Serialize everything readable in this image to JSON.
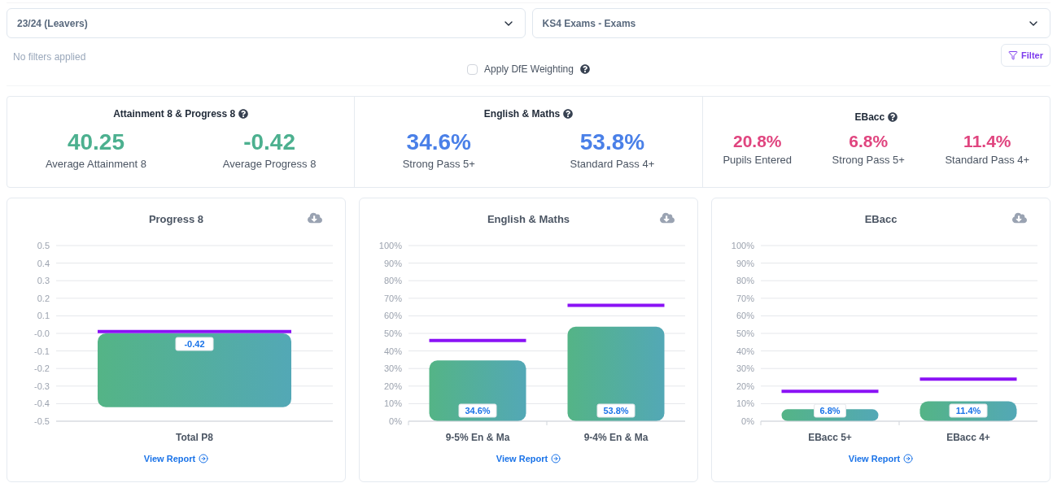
{
  "selects": [
    {
      "value": "23/24 (Leavers)"
    },
    {
      "value": "KS4 Exams - Exams"
    }
  ],
  "filters": {
    "status": "No filters applied",
    "button": "Filter"
  },
  "weighting": {
    "label": "Apply DfE Weighting",
    "checked": false
  },
  "summary": [
    {
      "title": "Attainment 8 & Progress 8",
      "color": "#4cb08f",
      "metrics": [
        {
          "value": "40.25",
          "label": "Average Attainment 8"
        },
        {
          "value": "-0.42",
          "label": "Average Progress 8"
        }
      ]
    },
    {
      "title": "English & Maths",
      "color": "#4a80e8",
      "metrics": [
        {
          "value": "34.6%",
          "label": "Strong Pass 5+"
        },
        {
          "value": "53.8%",
          "label": "Standard Pass 4+"
        }
      ]
    },
    {
      "title": "EBacc",
      "color": "#e0457f",
      "metrics": [
        {
          "value": "20.8%",
          "label": "Pupils Entered"
        },
        {
          "value": "6.8%",
          "label": "Strong Pass 5+"
        },
        {
          "value": "11.4%",
          "label": "Standard Pass 4+"
        }
      ]
    }
  ],
  "charts": [
    {
      "link": "View Report",
      "chart_data": {
        "type": "bar",
        "title": "Progress 8",
        "grid": true,
        "categories": [
          "Total P8"
        ],
        "series": [
          {
            "color": "#54b486",
            "values": [
              -0.42
            ]
          }
        ],
        "ref_lines": [
          {
            "axis": "y",
            "value": 0.01,
            "color": "#8a12f5"
          }
        ],
        "ylim": [
          -0.5,
          0.5
        ],
        "yticks": [
          {
            "value": 0.5,
            "label": "0.5"
          },
          {
            "value": 0.4,
            "label": "0.4"
          },
          {
            "value": 0.3,
            "label": "0.3"
          },
          {
            "value": 0.2,
            "label": "0.2"
          },
          {
            "value": 0.1,
            "label": "0.1"
          },
          {
            "value": 0,
            "label": "-0.0"
          },
          {
            "value": -0.1,
            "label": "-0.1"
          },
          {
            "value": -0.2,
            "label": "-0.2"
          },
          {
            "value": -0.3,
            "label": "-0.3"
          },
          {
            "value": -0.4,
            "label": "-0.4"
          },
          {
            "value": -0.5,
            "label": "-0.5"
          }
        ],
        "value_labels": [
          "-0.42"
        ]
      }
    },
    {
      "link": "View Report",
      "chart_data": {
        "type": "bar",
        "title": "English & Maths",
        "grid": true,
        "categories": [
          "9-5% En & Ma",
          "9-4% En & Ma"
        ],
        "series": [
          {
            "color": "#54b486",
            "values": [
              34.6,
              53.8
            ]
          }
        ],
        "ref_lines": [
          {
            "axis": "y",
            "value": 46,
            "color": "#8a12f5"
          },
          {
            "axis": "y",
            "value": 66,
            "color": "#8a12f5"
          }
        ],
        "ylim": [
          0,
          100
        ],
        "yticks": [
          {
            "value": 100,
            "label": "100%"
          },
          {
            "value": 90,
            "label": "90%"
          },
          {
            "value": 80,
            "label": "80%"
          },
          {
            "value": 70,
            "label": "70%"
          },
          {
            "value": 60,
            "label": "60%"
          },
          {
            "value": 50,
            "label": "50%"
          },
          {
            "value": 40,
            "label": "40%"
          },
          {
            "value": 30,
            "label": "30%"
          },
          {
            "value": 20,
            "label": "20%"
          },
          {
            "value": 10,
            "label": "10%"
          },
          {
            "value": 0,
            "label": "0%"
          }
        ],
        "value_labels": [
          "34.6%",
          "53.8%"
        ]
      }
    },
    {
      "link": "View Report",
      "chart_data": {
        "type": "bar",
        "title": "EBacc",
        "grid": true,
        "categories": [
          "EBacc 5+",
          "EBacc 4+"
        ],
        "series": [
          {
            "color": "#54b486",
            "values": [
              6.8,
              11.4
            ]
          }
        ],
        "ref_lines": [
          {
            "axis": "y",
            "value": 17,
            "color": "#8a12f5"
          },
          {
            "axis": "y",
            "value": 24,
            "color": "#8a12f5"
          }
        ],
        "ylim": [
          0,
          100
        ],
        "yticks": [
          {
            "value": 100,
            "label": "100%"
          },
          {
            "value": 90,
            "label": "90%"
          },
          {
            "value": 80,
            "label": "80%"
          },
          {
            "value": 70,
            "label": "70%"
          },
          {
            "value": 60,
            "label": "60%"
          },
          {
            "value": 50,
            "label": "50%"
          },
          {
            "value": 40,
            "label": "40%"
          },
          {
            "value": 30,
            "label": "30%"
          },
          {
            "value": 20,
            "label": "20%"
          },
          {
            "value": 10,
            "label": "10%"
          },
          {
            "value": 0,
            "label": "0%"
          }
        ],
        "value_labels": [
          "6.8%",
          "11.4%"
        ]
      }
    }
  ]
}
